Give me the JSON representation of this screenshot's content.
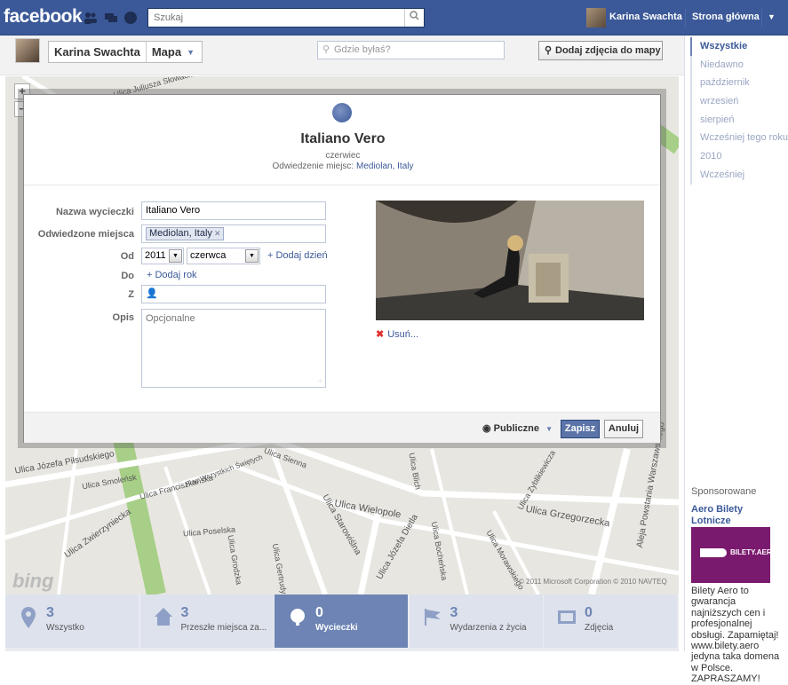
{
  "topbar": {
    "logo": "facebook",
    "search_placeholder": "Szukaj",
    "user_name": "Karina Swachta",
    "home": "Strona główna"
  },
  "header": {
    "crumb_name": "Karina Swachta",
    "crumb_section": "Mapa",
    "where_placeholder": "Gdzie byłaś?",
    "add_photos_label": "Dodaj zdjęcia do mapy"
  },
  "timeline": {
    "items": [
      "Wszystkie",
      "Niedawno",
      "październik",
      "wrzesień",
      "sierpień",
      "Wcześniej tego roku",
      "2010",
      "Wcześniej"
    ]
  },
  "ad": {
    "sponsored": "Sponsorowane",
    "title": "Aero Bilety Lotnicze",
    "image_brand": "BILETY.AERO",
    "text": "Bilety Aero to gwarancja najniższych cen i profesjonalnej obsługi. Zapamiętaj! www.bilety.aero jedyna taka domena w Polsce. ZAPRASZAMY!"
  },
  "map": {
    "streets": [
      "Ulica Józefa Piłsudskiego",
      "Ulica Smoleńsk",
      "Ulica Franciszkańska",
      "Ulica Zwierzyniecka",
      "Ulica Wielopole",
      "Ulica Grzegorzecka",
      "Ulica Starowiślna",
      "Aleja Powstania Warszawskiego",
      "Ulica Sienna",
      "Ulica Poselska",
      "Ulica Józefa Dietla",
      "Plac Wszystkich Świętych",
      "Ulica Grodzka",
      "Ulica Gertrudy",
      "Ulica Bocheńska",
      "Ulica Juliusza Słowackiego",
      "Ulica Blich",
      "Ulica Zyblikiewicza",
      "Ulica Morawskiego"
    ],
    "copyright": "© 2011 Microsoft Corporation © 2010 NAVTEQ",
    "bing": "bing"
  },
  "dialog": {
    "title": "Italiano Vero",
    "month": "czerwiec",
    "visited_prefix": "Odwiedzenie miejsc:",
    "visited_place": "Mediolan, Italy",
    "labels": {
      "trip_name": "Nazwa wycieczki",
      "places": "Odwiedzone miejsca",
      "from": "Od",
      "to": "Do",
      "with": "Z",
      "description": "Opis"
    },
    "trip_name_value": "Italiano Vero",
    "place_token": "Mediolan, Italy",
    "year": "2011",
    "month_select": "czerwca",
    "add_day": "Dodaj dzień",
    "add_year": "Dodaj rok",
    "description_placeholder": "Opcjonalne",
    "remove": "Usuń...",
    "privacy": "Publiczne",
    "save": "Zapisz",
    "cancel": "Anuluj"
  },
  "tabs": [
    {
      "count": "3",
      "label": "Wszystko"
    },
    {
      "count": "3",
      "label": "Przeszłe miejsca za..."
    },
    {
      "count": "0",
      "label": "Wycieczki"
    },
    {
      "count": "3",
      "label": "Wydarzenia z życia"
    },
    {
      "count": "0",
      "label": "Zdjęcia"
    }
  ],
  "colors": {
    "brand": "#3b5998",
    "accent": "#6d84b4",
    "save_button": "#5b74a8"
  },
  "icons": [
    "friends-icon",
    "messages-icon",
    "globe-icon",
    "search-icon",
    "pin-icon",
    "globe-icon",
    "close-icon",
    "chevron-down-icon",
    "home-icon",
    "flag-icon",
    "photos-icon"
  ]
}
